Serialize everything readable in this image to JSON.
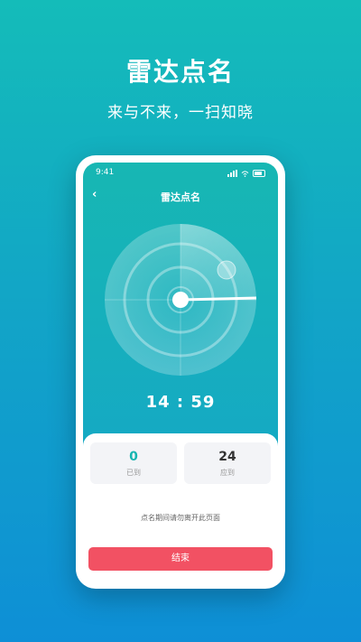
{
  "hero": {
    "title": "雷达点名",
    "subtitle": "来与不来，一扫知晓"
  },
  "phone": {
    "status_time": "9:41",
    "nav_title": "雷达点名",
    "back_icon": "‹",
    "timer": "14 : 59",
    "stats": [
      {
        "value": "0",
        "label": "已到",
        "color": "#17b5b0"
      },
      {
        "value": "24",
        "label": "应到",
        "color": "#333333"
      }
    ],
    "notice": "点名期间请勿离开此页面",
    "end_button": "结束"
  },
  "colors": {
    "accent": "#17b7b3",
    "danger": "#f25163"
  }
}
